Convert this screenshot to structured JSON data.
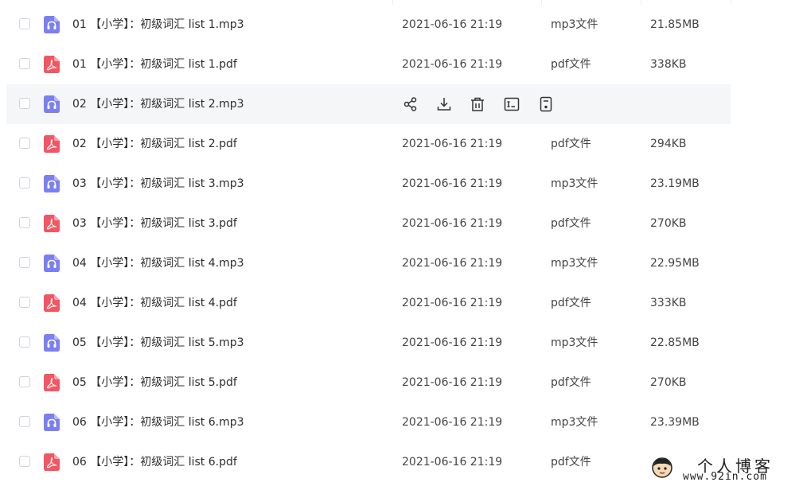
{
  "colors": {
    "mp3_icon": "#7b7ff2",
    "pdf_icon": "#f25563",
    "hover_row": "#f5f6f8",
    "action_icon": "#333333"
  },
  "files": [
    {
      "name": "01 【小学】：初级词汇 list 1.mp3",
      "date": "2021-06-16 21:19",
      "type": "mp3文件",
      "size": "21.85MB",
      "kind": "mp3",
      "hover": false
    },
    {
      "name": "01 【小学】：初级词汇 list 1.pdf",
      "date": "2021-06-16 21:19",
      "type": "pdf文件",
      "size": "338KB",
      "kind": "pdf",
      "hover": false
    },
    {
      "name": "02 【小学】：初级词汇 list 2.mp3",
      "date": "",
      "type": "",
      "size": "",
      "kind": "mp3",
      "hover": true
    },
    {
      "name": "02 【小学】：初级词汇 list 2.pdf",
      "date": "2021-06-16 21:19",
      "type": "pdf文件",
      "size": "294KB",
      "kind": "pdf",
      "hover": false
    },
    {
      "name": "03 【小学】：初级词汇 list 3.mp3",
      "date": "2021-06-16 21:19",
      "type": "mp3文件",
      "size": "23.19MB",
      "kind": "mp3",
      "hover": false
    },
    {
      "name": "03 【小学】：初级词汇 list 3.pdf",
      "date": "2021-06-16 21:19",
      "type": "pdf文件",
      "size": "270KB",
      "kind": "pdf",
      "hover": false
    },
    {
      "name": "04 【小学】：初级词汇 list 4.mp3",
      "date": "2021-06-16 21:19",
      "type": "mp3文件",
      "size": "22.95MB",
      "kind": "mp3",
      "hover": false
    },
    {
      "name": "04 【小学】：初级词汇 list 4.pdf",
      "date": "2021-06-16 21:19",
      "type": "pdf文件",
      "size": "333KB",
      "kind": "pdf",
      "hover": false
    },
    {
      "name": "05 【小学】：初级词汇 list 5.mp3",
      "date": "2021-06-16 21:19",
      "type": "mp3文件",
      "size": "22.85MB",
      "kind": "mp3",
      "hover": false
    },
    {
      "name": "05 【小学】：初级词汇 list 5.pdf",
      "date": "2021-06-16 21:19",
      "type": "pdf文件",
      "size": "270KB",
      "kind": "pdf",
      "hover": false
    },
    {
      "name": "06 【小学】：初级词汇 list 6.mp3",
      "date": "2021-06-16 21:19",
      "type": "mp3文件",
      "size": "23.39MB",
      "kind": "mp3",
      "hover": false
    },
    {
      "name": "06 【小学】：初级词汇 list 6.pdf",
      "date": "2021-06-16 21:19",
      "type": "pdf文件",
      "size": "",
      "kind": "pdf",
      "hover": false
    }
  ],
  "row_actions": [
    "share-icon",
    "download-icon",
    "delete-icon",
    "rename-icon",
    "more-info-icon"
  ],
  "watermark": {
    "title": "个人博客",
    "url": "www.92in.com"
  }
}
